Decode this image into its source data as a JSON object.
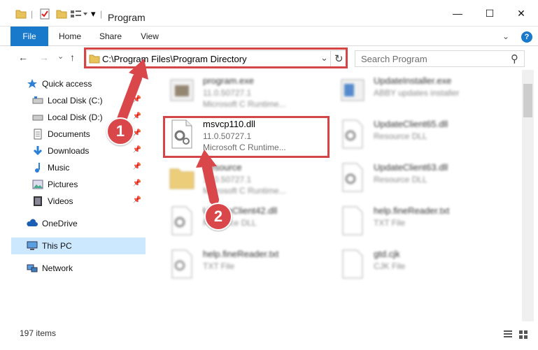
{
  "window": {
    "title": "Program",
    "minimize_glyph": "—",
    "maximize_glyph": "☐",
    "close_glyph": "✕"
  },
  "ribbon": {
    "tabs": [
      "File",
      "Home",
      "Share",
      "View"
    ],
    "expand_glyph": "⌄",
    "help_glyph": "?"
  },
  "address": {
    "path": "C:\\Program Files\\Program Directory",
    "dropdown_glyph": "⌄",
    "refresh_glyph": "↻"
  },
  "search": {
    "placeholder": "Search Program",
    "icon_glyph": "⚲"
  },
  "nav": {
    "back": "←",
    "forward": "→",
    "recent": "⌄",
    "up": "↑"
  },
  "sidebar": {
    "items": [
      {
        "label": "Quick access",
        "icon": "star-icon",
        "pinned": false
      },
      {
        "label": "Local Disk (C:)",
        "icon": "drive-icon",
        "pinned": true
      },
      {
        "label": "Local Disk (D:)",
        "icon": "drive-icon",
        "pinned": true
      },
      {
        "label": "Documents",
        "icon": "documents-icon",
        "pinned": true
      },
      {
        "label": "Downloads",
        "icon": "download-icon",
        "pinned": true
      },
      {
        "label": "Music",
        "icon": "music-icon",
        "pinned": true
      },
      {
        "label": "Pictures",
        "icon": "pictures-icon",
        "pinned": true
      },
      {
        "label": "Videos",
        "icon": "videos-icon",
        "pinned": true
      },
      {
        "label": "OneDrive",
        "icon": "cloud-icon",
        "pinned": false
      },
      {
        "label": "This PC",
        "icon": "computer-icon",
        "pinned": false
      },
      {
        "label": "Network",
        "icon": "network-icon",
        "pinned": false
      }
    ],
    "pin_glyph": "📌"
  },
  "files": {
    "left": [
      {
        "name": "program.exe",
        "line2": "11.0.50727.1",
        "line3": "Microsoft C Runtime..."
      },
      {
        "name": "msvcp110.dll",
        "line2": "11.0.50727.1",
        "line3": "Microsoft C Runtime..."
      },
      {
        "name": "Resource",
        "line2": "11.0.50727.1",
        "line3": "Microsoft C Runtime..."
      },
      {
        "name": "UpdateClient42.dll",
        "line2": "Resource DLL",
        "line3": ""
      },
      {
        "name": "help.fineReader.txt",
        "line2": "TXT File",
        "line3": ""
      }
    ],
    "right": [
      {
        "name": "UpdateInstaller.exe",
        "line2": "ABBY updates installer",
        "line3": ""
      },
      {
        "name": "UpdateClient65.dll",
        "line2": "Resource DLL",
        "line3": ""
      },
      {
        "name": "UpdateClient63.dll",
        "line2": "Resource DLL",
        "line3": ""
      },
      {
        "name": "help.fineReader.txt",
        "line2": "TXT File",
        "line3": ""
      },
      {
        "name": "gtd.cjk",
        "line2": "CJK File",
        "line3": ""
      }
    ]
  },
  "status": {
    "item_count": "197 items"
  },
  "annotations": {
    "step1": "1",
    "step2": "2"
  },
  "colors": {
    "accent": "#1979ca",
    "highlight": "#d64545",
    "selection": "#cce8ff"
  }
}
